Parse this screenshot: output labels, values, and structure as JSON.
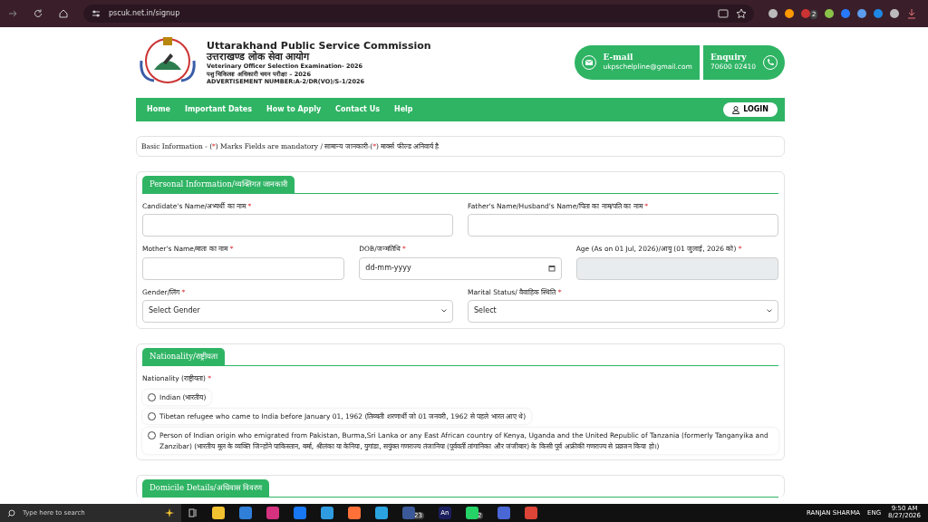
{
  "browser": {
    "url": "pscuk.net.in/signup",
    "extension_badge": "2"
  },
  "header": {
    "title": "Uttarakhand Public Service Commission",
    "title_hindi": "उत्तराखण्ड लोक सेवा आयोग",
    "lines": [
      "Veterinary Officer Selection Examination- 2026",
      "पशु चिकित्सा अधिकारी चयन परीक्षा – 2026",
      "ADVERTISEMENT NUMBER:A-2/DR(VO)/S-1/2026"
    ],
    "contacts": [
      {
        "kind": "email",
        "heading": "E-mail",
        "value": "ukpschelpline@gmail.com"
      },
      {
        "kind": "phone",
        "heading": "Enquiry",
        "value": "70600 02410"
      }
    ]
  },
  "nav": {
    "items": [
      "Home",
      "Important Dates",
      "How to Apply",
      "Contact Us",
      "Help"
    ],
    "login": "LOGIN"
  },
  "notice": [
    {
      "kind": "text",
      "text": "Basic Information - ("
    },
    {
      "kind": "mark",
      "text": "*"
    },
    {
      "kind": "text",
      "text": ") Marks Fields are mandatory / सामान्य जानकारी-("
    },
    {
      "kind": "mark",
      "text": "*"
    },
    {
      "kind": "text",
      "text": ") मार्क्स फील्ड अनिवार्य है"
    }
  ],
  "sections": [
    {
      "title": "Personal Information/व्यक्तिगत जानकारी",
      "rows": [
        [
          {
            "kind": "text",
            "label": "Candidate's Name/अभ्यर्थी का नाम",
            "mark": "*",
            "disabled": false
          },
          {
            "kind": "text",
            "label": "Father's Name/Husband's Name/पिता का नाम/पति का नाम",
            "mark": "*",
            "disabled": false
          }
        ],
        [
          {
            "kind": "text",
            "label": "Mother's Name/माता का नाम",
            "mark": "*",
            "disabled": false
          },
          {
            "kind": "date",
            "label": "DOB/जन्मतिथि",
            "mark": "*",
            "placeholder": "dd-mm-yyyy",
            "disabled": false
          },
          {
            "kind": "text",
            "label": "Age (As on 01 Jul, 2026)/आयु (01 जुलाई, 2026 को)",
            "mark": "*",
            "disabled": true
          }
        ],
        [
          {
            "kind": "select",
            "label": "Gender/लिंग",
            "mark": "*",
            "value": "Select Gender",
            "disabled": false
          },
          {
            "kind": "select",
            "label": "Marital Status/ वैवाहिक स्थिति",
            "mark": "*",
            "value": "Select",
            "disabled": false
          }
        ]
      ]
    },
    {
      "title": "Nationality/राष्ट्रीयता",
      "question": "Nationality (राष्ट्रीयता)",
      "mark": "*",
      "options": [
        {
          "label": "Indian (भारतीय)",
          "selected": false
        },
        {
          "label": "Tibetan refugee who came to India before January 01, 1962 (तिब्बती शरणार्थी जो 01 जनवरी, 1962 से पहले भारत आए थे)",
          "selected": false
        },
        {
          "label": "Person of Indian origin who emigrated from Pakistan, Burma,Sri Lanka or any East African country of Kenya, Uganda and the United Republic of Tanzania (formerly Tanganyika and Zanzibar) (भारतीय मूल के व्यक्ति जिन्होंने पाकिस्तान, बर्मा, श्रीलंका या केनिया, युगांडा, सयुंक्त गणराज्य तंजानिया (पूर्ववर्ती तांगानिका और जंजीबार) के किसी पूर्व अफ्रीकी गणराज्य से प्रव्रजन किया हो।)",
          "selected": false
        }
      ]
    },
    {
      "title": "Domicile Details/अधिवास विवरण"
    }
  ],
  "taskbar": {
    "search_placeholder": "Type here to search",
    "apps": [
      {
        "color": "#f2c230"
      },
      {
        "color": "#2f7fd8"
      },
      {
        "color": "#d6327f"
      },
      {
        "color": "#1877f2"
      },
      {
        "color": "#2f9be0"
      },
      {
        "color": "#ff7139"
      },
      {
        "color": "#2aa3df"
      },
      {
        "color": "#3b5998",
        "badge": "23"
      },
      {
        "color": "#1b1f5e",
        "label": "An"
      },
      {
        "color": "#25d366",
        "badge": "2"
      },
      {
        "color": "#4a67d6"
      },
      {
        "color": "#db4437"
      }
    ],
    "user": "RANJAN SHARMA",
    "lang": "ENG",
    "time": "9:50 AM",
    "date": "8/27/2026"
  }
}
